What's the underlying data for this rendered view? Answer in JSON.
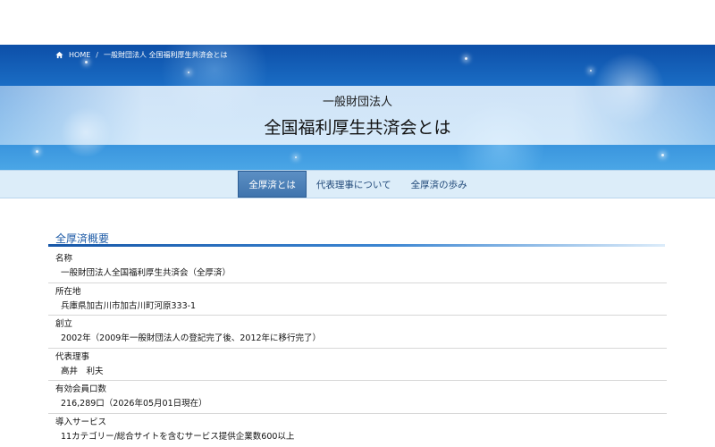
{
  "breadcrumb": {
    "home_label": "HOME",
    "separator": "/",
    "current": "一般財団法人 全国福利厚生共済会とは"
  },
  "hero": {
    "subtitle": "一般財団法人",
    "title": "全国福利厚生共済会とは"
  },
  "tabs": [
    {
      "label": "全厚済とは",
      "active": true
    },
    {
      "label": "代表理事について",
      "active": false
    },
    {
      "label": "全厚済の歩み",
      "active": false
    }
  ],
  "section": {
    "title": "全厚済概要"
  },
  "info": [
    {
      "label": "名称",
      "value": "一般財団法人全国福利厚生共済会（全厚済）"
    },
    {
      "label": "所在地",
      "value": "兵庫県加古川市加古川町河原333-1"
    },
    {
      "label": "創立",
      "value": "2002年（2009年一般財団法人の登記完了後、2012年に移行完了）"
    },
    {
      "label": "代表理事",
      "value": "高井　利夫"
    },
    {
      "label": "有効会員口数",
      "value": "216,289口（2026年05月01日現在）"
    },
    {
      "label": "導入サービス",
      "value": "11カテゴリー/総合サイトを含むサービス提供企業数600以上"
    }
  ],
  "colors": {
    "accent": "#1c5aa6",
    "tab_active_bg": "#4a7fb8",
    "tabs_bar_bg": "#dcedf9"
  }
}
